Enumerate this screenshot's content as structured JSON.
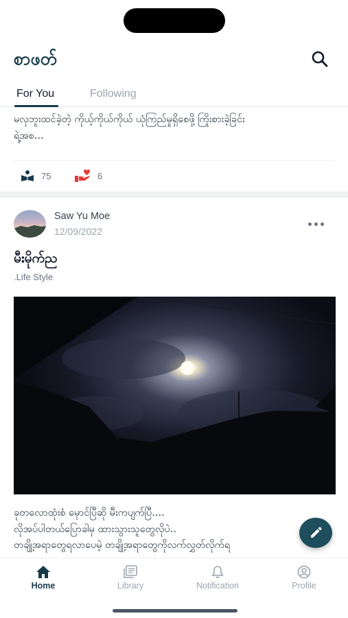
{
  "app": {
    "title": "စာဖတ်"
  },
  "tabs": [
    {
      "label": "For You",
      "active": true
    },
    {
      "label": "Following",
      "active": false
    }
  ],
  "previous_post": {
    "excerpt_line1": "မလှဘူးထင်ခဲ့တဲ့ ကိုယ့်ကိုယ်ကိုယ် ယုံကြည်မှုရှိစေဖို့ ကြိုးစားခဲ့ခြင်း",
    "excerpt_line2": "ရဲ့အစ...",
    "reads": "75",
    "likes": "6"
  },
  "post": {
    "author": "Saw Yu Moe",
    "date": "12/09/2022",
    "title": "မီးမိုက်ည",
    "category": ".Life Style",
    "body": [
      "ခုတလောထုံးစံ မှောင်ပြီဆို မီးကပျက်ပြီ....",
      "လိုအပ်ပါတယ်ပြောခါမှ ထားသွားသူတွေလိုပဲ..",
      "တချို့အရာတွေရလာပေမဲ့     တချို့အရာတွေကိုလက်လွှတ်လိုက်ရ"
    ]
  },
  "bottom_nav": [
    {
      "label": "Home",
      "icon": "home-icon",
      "active": true
    },
    {
      "label": "Library",
      "icon": "library-icon",
      "active": false
    },
    {
      "label": "Notification",
      "icon": "bell-icon",
      "active": false
    },
    {
      "label": "Profile",
      "icon": "profile-icon",
      "active": false
    }
  ],
  "colors": {
    "primary": "#163a4a",
    "fab": "#1e4d5c",
    "like_red": "#e53935",
    "muted": "#9ca3af"
  }
}
